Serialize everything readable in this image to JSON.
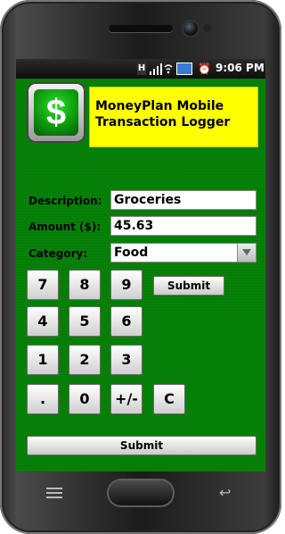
{
  "status_bar": {
    "network_badge": "H",
    "time": "9:06 PM",
    "icons": [
      "network-h-icon",
      "signal-icon",
      "wifi-icon",
      "battery-icon",
      "alarm-icon"
    ]
  },
  "header": {
    "logo_symbol": "$",
    "title_line1": "MoneyPlan Mobile",
    "title_line2": "Transaction Logger"
  },
  "form": {
    "description_label": "Description:",
    "description_value": "Groceries",
    "amount_label": "Amount ($):",
    "amount_value": "45.63",
    "category_label": "Category:",
    "category_value": "Food"
  },
  "keypad": {
    "k7": "7",
    "k8": "8",
    "k9": "9",
    "k4": "4",
    "k5": "5",
    "k6": "6",
    "k1": "1",
    "k2": "2",
    "k3": "3",
    "kdot": ".",
    "k0": "0",
    "ksign": "+/-",
    "kclear": "C"
  },
  "buttons": {
    "submit_small": "Submit",
    "submit_wide": "Submit"
  },
  "colors": {
    "background_green": "#078207",
    "title_yellow": "#ffff00"
  }
}
